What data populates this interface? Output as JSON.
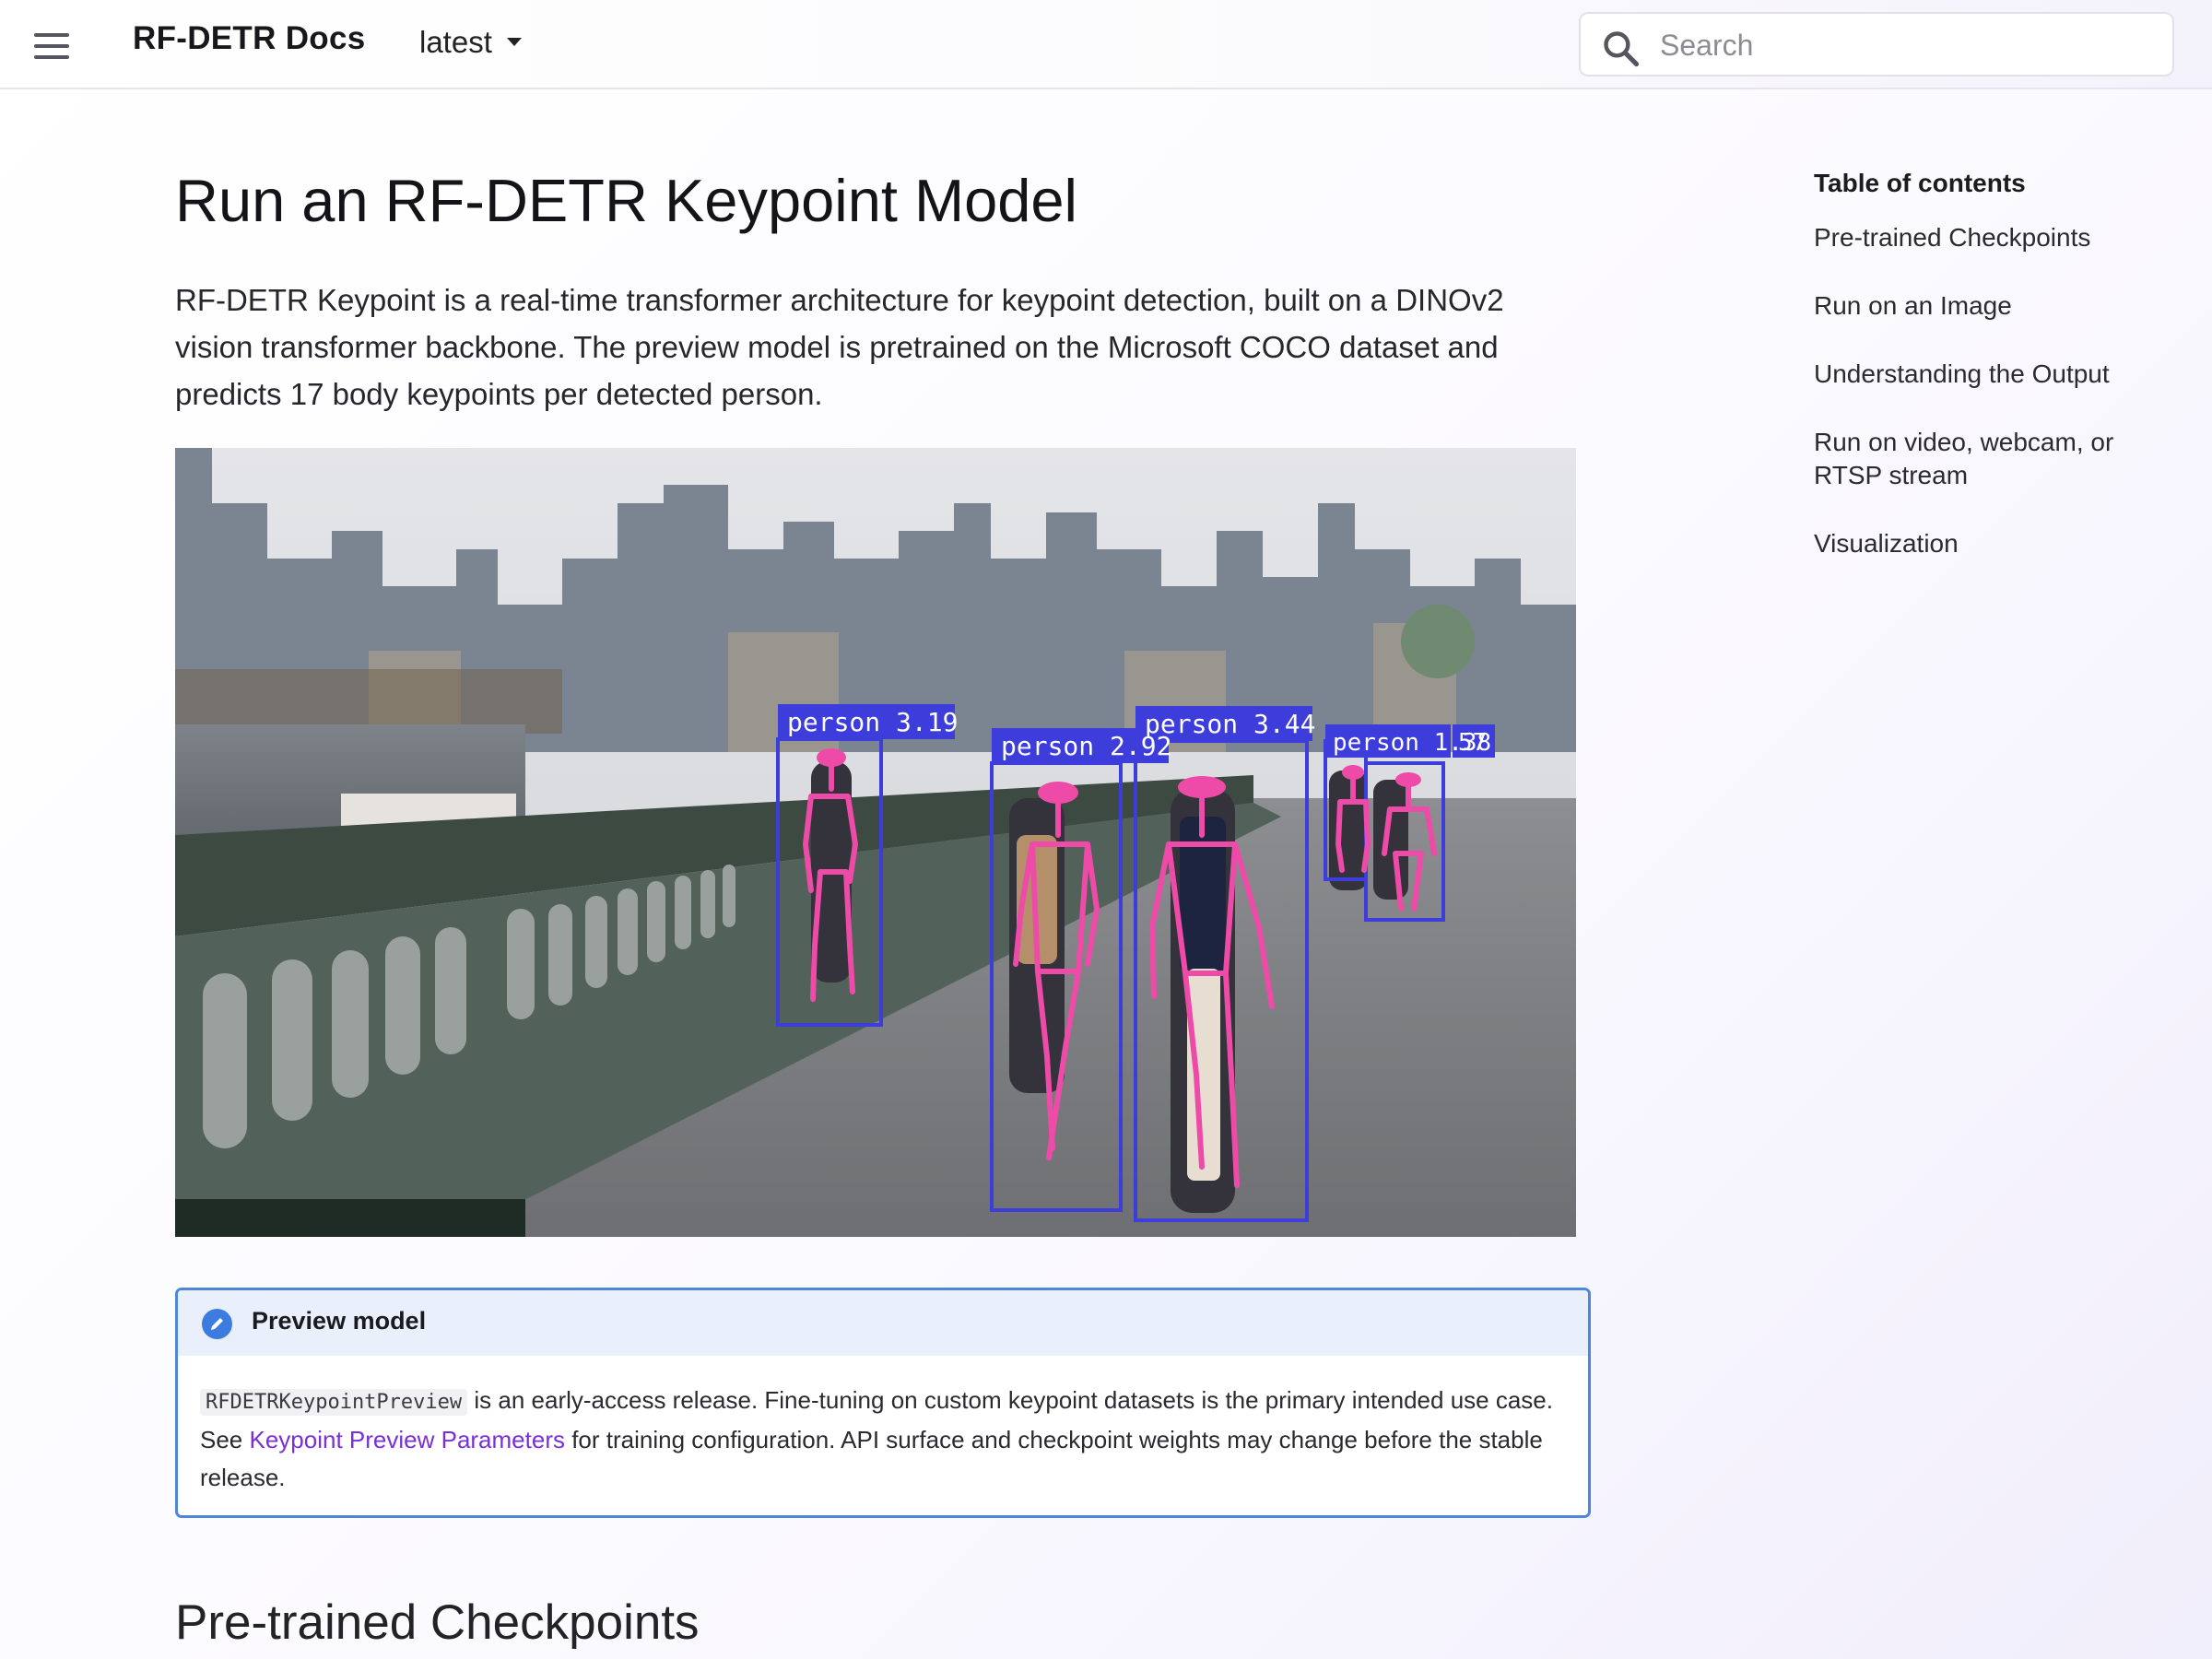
{
  "header": {
    "site_title": "RF-DETR Docs",
    "version": "latest",
    "search_placeholder": "Search",
    "icons": {
      "menu": "hamburger-menu-icon",
      "search": "search-icon",
      "version": "caret-down-icon"
    }
  },
  "main": {
    "title": "Run an RF-DETR Keypoint Model",
    "intro": "RF-DETR Keypoint is a real-time transformer architecture for keypoint detection, built on a DINOv2 vision transformer backbone. The preview model is pretrained on the Microsoft COCO dataset and predicts 17 body keypoints per detected person.",
    "hero_image": {
      "detections": [
        {
          "label": "person 3.19"
        },
        {
          "label": "person 2.92"
        },
        {
          "label": "person 3.44"
        },
        {
          "label": "person 1.38"
        },
        {
          "label": "57"
        }
      ],
      "colors": {
        "box": "#3d3ddb",
        "keypoints": "#ee4aa8"
      }
    },
    "admonition": {
      "title": "Preview model",
      "icon": "pencil-icon",
      "code": "RFDETRKeypointPreview",
      "text_1": " is an early-access release. Fine-tuning on custom keypoint datasets is the primary intended use case. See ",
      "link": "Keypoint Preview Parameters",
      "text_2": " for training configuration. API surface and checkpoint weights may change before the stable release."
    },
    "section_heading": "Pre-trained Checkpoints"
  },
  "toc": {
    "title": "Table of contents",
    "items": [
      "Pre-trained Checkpoints",
      "Run on an Image",
      "Understanding the Output",
      "Run on video, webcam, or RTSP stream",
      "Visualization"
    ]
  },
  "colors": {
    "accent": "#4e86da",
    "link": "#7a2fd8"
  }
}
